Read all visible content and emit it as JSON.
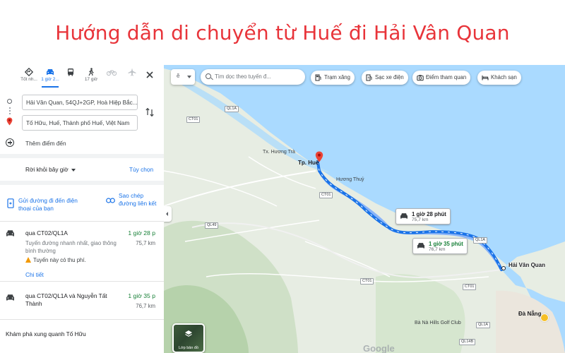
{
  "headline": "Hướng dẫn di chuyển từ Huế đi Hải Vân Quan",
  "modes": [
    {
      "label": "Tốt nh...",
      "icon": "diamond-directions-icon"
    },
    {
      "label": "1 giờ 2...",
      "icon": "car-icon",
      "active": true
    },
    {
      "label": "",
      "icon": "bus-icon"
    },
    {
      "label": "17 giờ",
      "icon": "walking-icon"
    },
    {
      "label": "",
      "icon": "bicycle-icon"
    },
    {
      "label": "",
      "icon": "airplane-icon"
    }
  ],
  "origin_value": "Hải Vân Quan, 54QJ+2GP, Hoà Hiệp Bắc...",
  "destination_value": "Tố Hữu, Huế, Thành phố Huế, Việt Nam",
  "add_destination": "Thêm điểm đến",
  "leave_now": "Rời khỏi bây giờ",
  "options": "Tùy chọn",
  "send_to_phone": "Gửi đường đi đến điện thoại của bạn",
  "copy_link": "Sao chép đường liên kết",
  "routes": [
    {
      "via": "qua CT02/QL1A",
      "time": "1 giờ 28 p",
      "distance": "75,7 km",
      "description": "Tuyến đường nhanh nhất, giao thông bình thường",
      "toll": "Tuyến này có thu phí.",
      "details": "Chi tiết"
    },
    {
      "via": "qua CT02/QL1A và Nguyễn Tất Thành",
      "time": "1 giờ 35 p",
      "distance": "76,7 km"
    }
  ],
  "explore": "Khám phá xung quanh Tố Hữu",
  "map": {
    "search_placeholder": "Tìm dọc theo tuyến đ...",
    "menu_letter": "ĕ",
    "chips": [
      {
        "label": "Trạm xăng",
        "icon": "gas-station-icon"
      },
      {
        "label": "Sạc xe điện",
        "icon": "ev-charger-icon"
      },
      {
        "label": "Điểm tham quan",
        "icon": "camera-icon"
      },
      {
        "label": "Khách sạn",
        "icon": "hotel-icon"
      }
    ],
    "labels": {
      "hue": "Tp. Huế",
      "huong_tra": "Tx. Hương Trà",
      "huong_thuy": "Hương Thuỷ",
      "hai_van": "Hải Vân Quan",
      "da_nang": "Đà Nẵng",
      "golf": "Bà Nà Hills Golf Club",
      "layer": "Lớp bản đồ",
      "google": "Google"
    },
    "road_shields": [
      "QL1A",
      "CT01",
      "CT01",
      "QL49",
      "QL1A",
      "CT01",
      "CT01",
      "QL1A",
      "QL14B"
    ],
    "callout_main": {
      "time": "1 giờ 28 phút",
      "distance": "75,7 km"
    },
    "callout_alt": {
      "time": "1 giờ 35 phút",
      "distance": "76,7 km"
    },
    "colors": {
      "route": "#1a73e8",
      "alt_route": "#8ab4f8",
      "sea": "#aadaff",
      "land": "#e7ede3"
    }
  }
}
